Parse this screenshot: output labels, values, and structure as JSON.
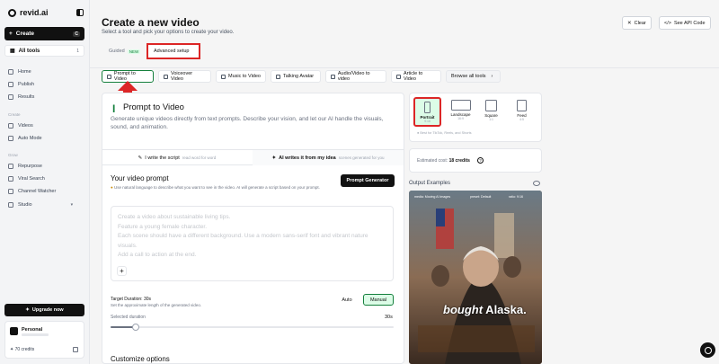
{
  "sidebar": {
    "logo": "revid.ai",
    "create_label": "Create",
    "create_shortcut": "C",
    "alltools_label": "All tools",
    "alltools_count": "1",
    "nav_top": [
      {
        "label": "Home",
        "icon": "home-icon"
      },
      {
        "label": "Publish",
        "icon": "publish-icon"
      },
      {
        "label": "Results",
        "icon": "results-icon"
      }
    ],
    "section_create": "Create",
    "nav_create": [
      {
        "label": "Videos",
        "icon": "video-icon"
      },
      {
        "label": "Auto Mode",
        "icon": "auto-mode-icon"
      }
    ],
    "section_grow": "Grow",
    "nav_grow": [
      {
        "label": "Repurpose",
        "icon": "repurpose-icon"
      },
      {
        "label": "Viral Search",
        "icon": "search-icon"
      },
      {
        "label": "Channel Watcher",
        "icon": "channel-icon"
      },
      {
        "label": "Studio",
        "icon": "studio-icon"
      }
    ],
    "upgrade_label": "Upgrade now",
    "account_name": "Personal",
    "credits": "70 credits"
  },
  "header": {
    "title": "Create a new video",
    "subtitle": "Select a tool and pick your options to create your video.",
    "clear_label": "Clear",
    "api_label": "See API Code"
  },
  "mode_tabs": {
    "guided": "Guided",
    "guided_badge": "NEW",
    "advanced": "Advanced setup"
  },
  "tool_tabs": [
    "Prompt to Video",
    "Voiceover Video",
    "Music to Video",
    "Talking Avatar",
    "Audio/Video to video",
    "Article to Video",
    "Browse all tools"
  ],
  "prompt_panel": {
    "title": "Prompt to Video",
    "description": "Generate unique videos directly from text prompts. Describe your vision, and let our AI handle the visuals, sound, and animation.",
    "tab_script": "I write the script",
    "tab_script_hint": "read word for word",
    "tab_ai": "AI writes it from my idea",
    "tab_ai_hint": "scenes generated for you",
    "your_prompt": "Your video prompt",
    "prompt_note": "Use natural language to describe what you want to see in the video. AI will generate a script based on your prompt.",
    "prompt_generator": "Prompt Generator",
    "placeholder": "Create a video about sustainable living tips.\nFeature a young female character.\nEach scene should have a different background. Use a modern sans-serif font and vibrant nature visuals.\nAdd a call to action at the end.",
    "target_duration": "Target Duration: 30s",
    "target_sub": "Set the approximate length of the generated video.",
    "auto_label": "Auto",
    "manual_label": "Manual",
    "selected_duration": "Selected duration",
    "duration_value": "30s",
    "slider_fraction": 0.09,
    "customize": "Customize options"
  },
  "aspect": {
    "options": [
      {
        "label": "Portrait",
        "ratio": "9:16"
      },
      {
        "label": "Landscape",
        "ratio": "16:9"
      },
      {
        "label": "Square",
        "ratio": "1:1"
      },
      {
        "label": "Feed",
        "ratio": "4:5"
      }
    ],
    "note": "Best for TikTok, Reels, and Shorts"
  },
  "cost": {
    "label": "Estimated cost:",
    "value": "18 credits"
  },
  "examples": {
    "title": "Output Examples",
    "tags": [
      "media: Moving AI images",
      "preset: Default",
      "ratio: 9:16"
    ],
    "caption_a": "bought",
    "caption_b": " Alaska."
  },
  "colors": {
    "accent_green": "#15803d",
    "highlight_red": "#dc2626",
    "dark": "#111111"
  }
}
